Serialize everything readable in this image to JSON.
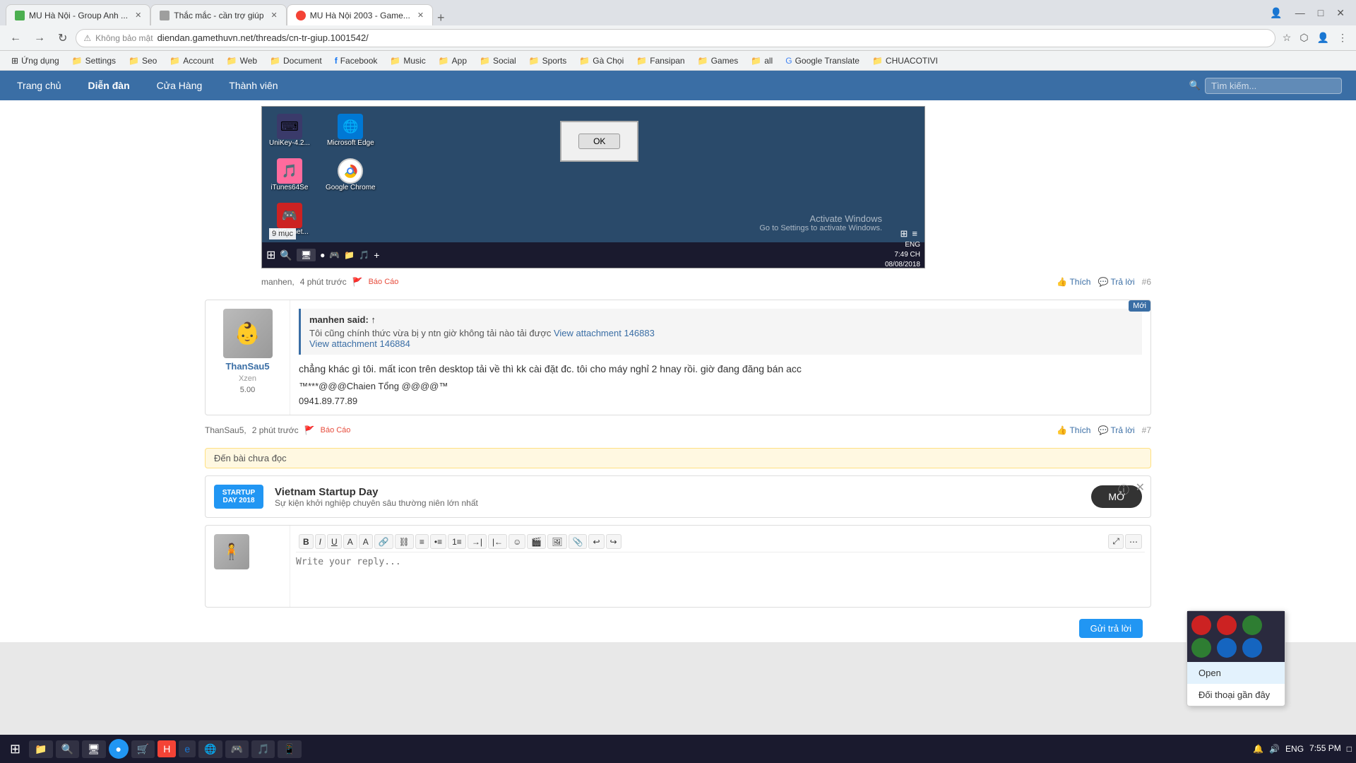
{
  "browser": {
    "tabs": [
      {
        "id": "tab1",
        "label": "MU Hà Nội - Group Anh ...",
        "favicon_color": "#4CAF50",
        "active": false
      },
      {
        "id": "tab2",
        "label": "Thắc mắc - cần trợ giúp",
        "favicon_color": "#9E9E9E",
        "active": false
      },
      {
        "id": "tab3",
        "label": "MU Hà Nội 2003 - Game...",
        "favicon_color": "#f44336",
        "active": true
      }
    ],
    "address": "diendan.gamethuvn.net/threads/cn-tr-giup.1001542/",
    "security": "Không bảo mật"
  },
  "bookmarks": [
    {
      "label": "Ứng dụng",
      "type": "folder"
    },
    {
      "label": "Settings",
      "type": "folder"
    },
    {
      "label": "Seo",
      "type": "folder"
    },
    {
      "label": "Account",
      "type": "folder"
    },
    {
      "label": "Web",
      "type": "folder"
    },
    {
      "label": "Document",
      "type": "folder"
    },
    {
      "label": "Facebook",
      "type": "item"
    },
    {
      "label": "Music",
      "type": "folder"
    },
    {
      "label": "App",
      "type": "folder"
    },
    {
      "label": "Social",
      "type": "folder"
    },
    {
      "label": "Sports",
      "type": "folder"
    },
    {
      "label": "Gà Chọi",
      "type": "folder"
    },
    {
      "label": "Fansipan",
      "type": "folder"
    },
    {
      "label": "Games",
      "type": "folder"
    },
    {
      "label": "all",
      "type": "folder"
    },
    {
      "label": "Google Translate",
      "type": "item"
    },
    {
      "label": "CHUACOTIVI",
      "type": "folder"
    }
  ],
  "site": {
    "nav": [
      "Trang chủ",
      "Diễn đàn",
      "Cửa Hàng",
      "Thành viên"
    ],
    "search_placeholder": "Tìm kiếm..."
  },
  "screenshot": {
    "icons": [
      {
        "label": "UniKey-4.2...",
        "emoji": "⌨"
      },
      {
        "label": "Microsoft Edge",
        "emoji": "🌐"
      },
      {
        "label": "iTunes64Se",
        "emoji": "🎵"
      },
      {
        "label": "Google Chrome",
        "emoji": "●"
      },
      {
        "label": "MUGamet...",
        "emoji": "🎮"
      }
    ],
    "dialog_btn": "OK",
    "count_label": "9 mục",
    "activate_line1": "Activate Windows",
    "activate_line2": "Go to Settings to activate Windows.",
    "taskbar_time": "7:49 CH",
    "taskbar_date": "08/08/2018",
    "taskbar_lang": "ENG"
  },
  "posts": [
    {
      "id": "post6",
      "author": "manhen",
      "time": "4 phút trước",
      "report_label": "Báo Cáo",
      "like_label": "Thích",
      "reply_label": "Trả lời",
      "number": "#6",
      "is_new": false
    },
    {
      "id": "post7",
      "author": "ThanSau5",
      "avatar_emoji": "👶",
      "time": "2 phút trước",
      "report_label": "Báo Cáo",
      "like_label": "Thích",
      "reply_label": "Trả lời",
      "number": "#7",
      "is_new": true,
      "badge": "Mới",
      "rank": "Xzen",
      "score": "5.00",
      "quote_author": "manhen said: ↑",
      "quote_text": "Tôi cũng chính thức vừa bị y ntn giờ không tải nào tải được",
      "quote_link1": "View attachment 146883",
      "quote_link2": "View attachment 146884",
      "content": "chẳng khác gì tôi. mất icon trên desktop tải về thì kk cài đặt đc. tôi cho máy nghỉ 2 hnay rồi. giờ đang đăng bán acc",
      "contact": "***@@@Chaien Tổng @@@@™",
      "phone": "0941.89.77.89"
    }
  ],
  "unread_divider": "Đến bài chưa đọc",
  "ad": {
    "logo_line1": "STARTUP",
    "logo_line2": "DAY 2018",
    "title": "Vietnam Startup Day",
    "subtitle": "Sự kiện khởi nghiệp chuyên sâu thường niên lớn nhất",
    "btn_label": "MỞ"
  },
  "editor": {
    "placeholder": "Write your reply...",
    "submit_label": "Gửi trả lời",
    "tools": [
      "B",
      "I",
      "U",
      "A",
      "A",
      "↔",
      "↕",
      "≡",
      "≡",
      "▼",
      "▲",
      "☺",
      "🖼",
      "📷",
      "📎",
      "←",
      "→"
    ]
  },
  "context_menu": {
    "icons_row1": [
      "🔴",
      "🔴",
      "🟢"
    ],
    "icons_row2": [
      "🟢",
      "🔵",
      "🔵"
    ],
    "open_label": "Open",
    "dialog_label": "Đối thoại gần đây"
  },
  "taskbar": {
    "lang": "ENG",
    "time": "7:55 PM"
  }
}
